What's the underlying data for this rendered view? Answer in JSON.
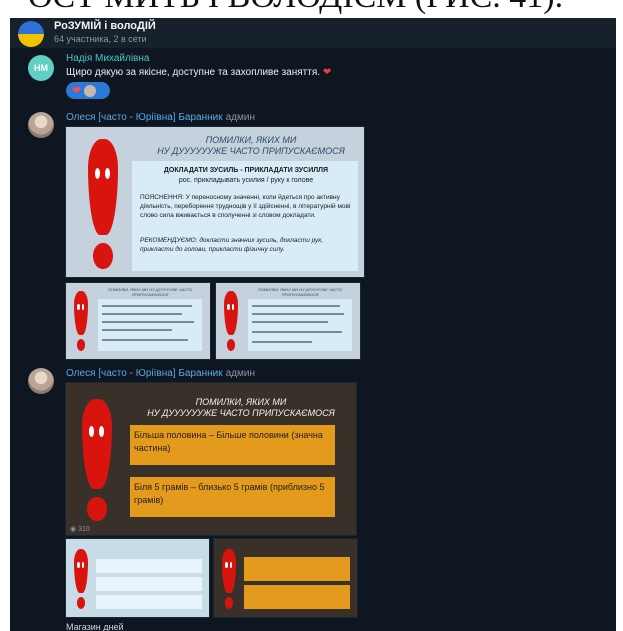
{
  "top_strip_text": "ОЄТ МИТЬ І ВОЛОДІЄМ (РИС. 41).",
  "channel": {
    "title": "РоЗУМІЙ і волоДІЙ",
    "subtitle": "64 участника, 2 в сети"
  },
  "message1": {
    "avatar_initials": "НМ",
    "author": "Надія Михайлівна",
    "text": "Щиро дякую за якісне, доступне та захопливе заняття.",
    "reaction_icon": "heart-icon"
  },
  "message2": {
    "author": "Олеся [часто - Юріївна] Баранник",
    "role": "админ",
    "slide": {
      "banner_line1": "ПОМИЛКИ, ЯКИХ МИ",
      "banner_line2": "НУ ДУУУУУУЖЕ ЧАСТО ПРИПУСКАЄМОСЯ",
      "heading": "ДОКЛАДАТИ ЗУСИЛЬ - ПРИКЛАДАТИ ЗУСИЛЛЯ",
      "subheading": "рос. прикладывать усилия / руку к голове",
      "explanation": "ПОЯСНЕННЯ: У переносному значенні, коли йдеться про активну діяльність, переборення труднощів у її здійсненні, в літературній мові слово сила вживається в сполученні зі словом докладати.",
      "recommendation": "РЕКОМЕНДУЄМО: докласти значних зусиль, докласти рук, прикласти до голови, прикласти фізичну силу."
    },
    "thumb_left_title": "ПОМИЛКИ, ЯКИХ МИ НУ ДУУУУУЖЕ ЧАСТО ПРИПУСКАЄМОСЯ",
    "thumb_right_title": "ПОМИЛКИ, ЯКИХ МИ НУ ДУУУУУЖЕ ЧАСТО ПРИПУСКАЄМОСЯ"
  },
  "message3": {
    "author": "Олеся [часто - Юріївна] Баранник",
    "role": "админ",
    "slide": {
      "banner_line1": "ПОМИЛКИ, ЯКИХ МИ",
      "banner_line2": "НУ ДУУУУУУЖЕ ЧАСТО ПРИПУСКАЄМОСЯ",
      "box1": "Більша половина – Більше половини (значна частина)",
      "box2": "Біля 5 грамів – близько 5 грамів (приблизно 5 грамів)"
    },
    "views": "310"
  },
  "footer_text": "Магазин дней"
}
